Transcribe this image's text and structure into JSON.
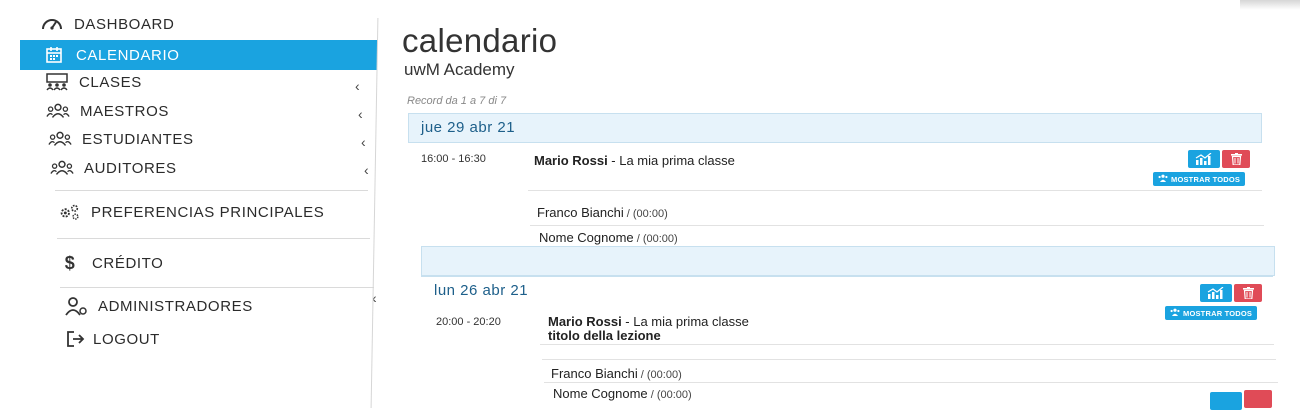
{
  "sidebar": {
    "items": [
      {
        "label": "DASHBOARD",
        "icon": "dashboard-icon"
      },
      {
        "label": "CALENDARIO",
        "icon": "calendar-icon",
        "active": true
      },
      {
        "label": "CLASES",
        "icon": "classes-icon",
        "has_children": true
      },
      {
        "label": "MAESTROS",
        "icon": "users-icon",
        "has_children": true
      },
      {
        "label": "ESTUDIANTES",
        "icon": "users-icon",
        "has_children": true
      },
      {
        "label": "AUDITORES",
        "icon": "users-icon",
        "has_children": true
      },
      {
        "label": "PREFERENCIAS PRINCIPALES",
        "icon": "gears-icon"
      },
      {
        "label": "CRÉDITO",
        "icon": "dollar-icon"
      },
      {
        "label": "ADMINISTRADORES",
        "icon": "admin-user-icon",
        "has_children": true
      },
      {
        "label": "LOGOUT",
        "icon": "logout-icon"
      }
    ]
  },
  "main": {
    "title": "calendario",
    "subtitle": "uwM Academy",
    "record_info": "Record da 1 a 7 di 7",
    "show_all_label": "MOSTRAR TODOS",
    "days": [
      {
        "date": "jue 29 abr 21",
        "lessons": [
          {
            "time": "16:00 - 16:30",
            "teacher": "Mario Rossi",
            "class_name": " - La mia prima classe",
            "lesson_title": "",
            "students": [
              {
                "name": "Franco Bianchi",
                "duration": " / (00:00)"
              },
              {
                "name": "Nome Cognome",
                "duration": " / (00:00)"
              }
            ]
          }
        ]
      },
      {
        "date": "lun 26 abr 21",
        "lessons": [
          {
            "time": "20:00 - 20:20",
            "teacher": "Mario Rossi",
            "class_name": " - La mia prima classe",
            "lesson_title": "titolo della lezione",
            "students": [
              {
                "name": "Franco Bianchi",
                "duration": " / (00:00)"
              },
              {
                "name": "Nome Cognome",
                "duration": " / (00:00)"
              }
            ]
          }
        ]
      }
    ]
  },
  "colors": {
    "accent": "#1aa3e0",
    "danger": "#e04b57",
    "date_bar": "#e7f3fb",
    "date_text": "#1d5f8a"
  }
}
